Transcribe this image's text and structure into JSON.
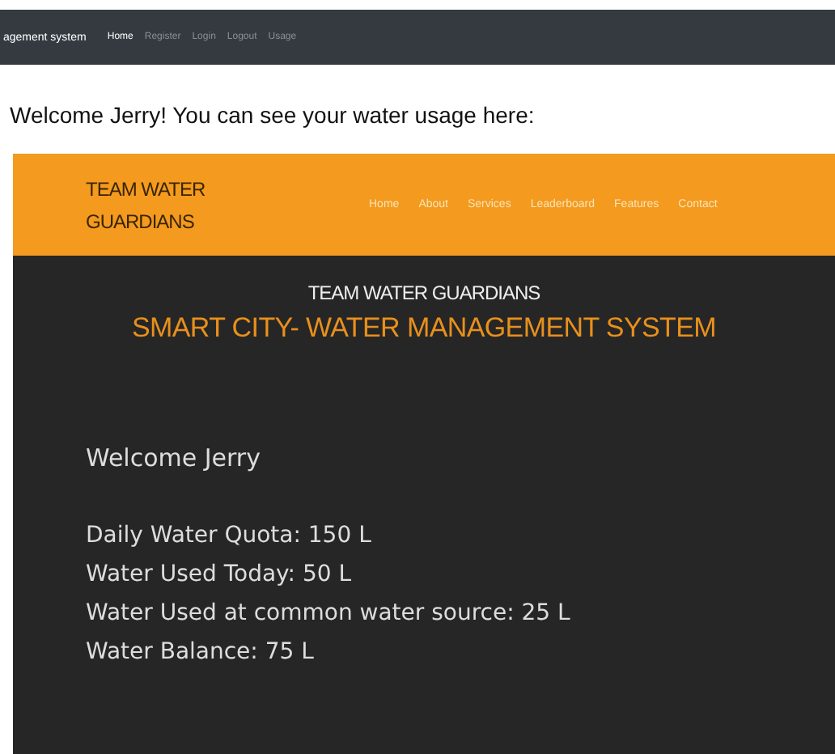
{
  "navbar": {
    "brand": "agement system",
    "links": [
      {
        "label": "Home",
        "selected": true
      },
      {
        "label": "Register",
        "selected": false
      },
      {
        "label": "Login",
        "selected": false
      },
      {
        "label": "Logout",
        "selected": false
      },
      {
        "label": "Usage",
        "selected": false
      }
    ]
  },
  "greeting": "Welcome Jerry! You can see your water usage here:",
  "site": {
    "logo": [
      "TEAM WATER",
      "GUARDIANS"
    ],
    "links": [
      "Home",
      "About",
      "Services",
      "Leaderboard",
      "Features",
      "Contact"
    ],
    "team": "TEAM WATER GUARDIANS",
    "title": "SMART CITY- WATER MANAGEMENT SYSTEM",
    "welcome": "Welcome Jerry",
    "stats": [
      "Daily Water Quota: 150 L",
      "Water Used Today: 50 L",
      "Water Used at common water source: 25 L",
      "Water Balance: 75 L"
    ]
  }
}
